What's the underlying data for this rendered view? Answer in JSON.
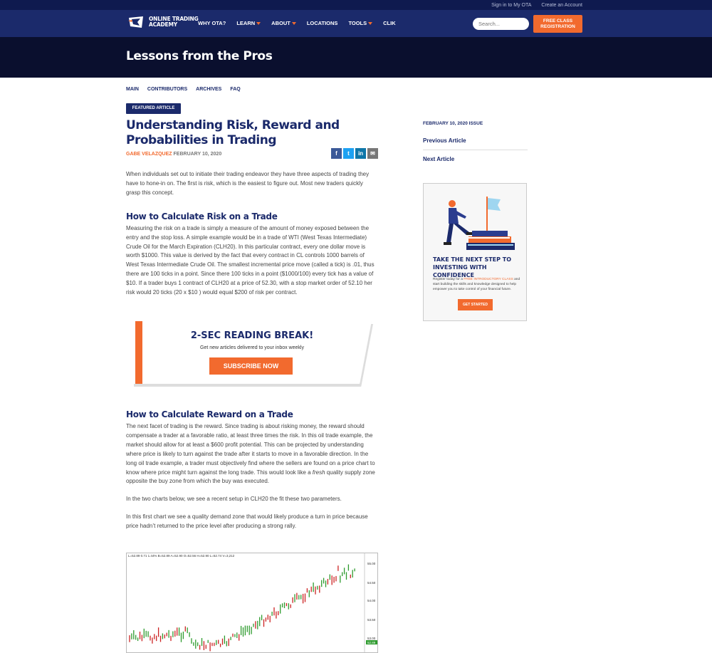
{
  "topbar": {
    "sign_in": "Sign in to My OTA",
    "create_account": "Create an Account"
  },
  "header": {
    "logo_line1": "ONLINE TRADING",
    "logo_line2": "ACADEMY",
    "nav": [
      {
        "label": "WHY OTA?",
        "has_caret": false
      },
      {
        "label": "LEARN",
        "has_caret": true
      },
      {
        "label": "ABOUT",
        "has_caret": true
      },
      {
        "label": "LOCATIONS",
        "has_caret": false
      },
      {
        "label": "TOOLS",
        "has_caret": true
      },
      {
        "label": "CLIK",
        "has_caret": false
      }
    ],
    "search_placeholder": "Search...",
    "register_line1": "FREE CLASS",
    "register_line2": "REGISTRATION"
  },
  "hero": {
    "title": "Lessons from the Pros"
  },
  "subnav": [
    "MAIN",
    "CONTRIBUTORS",
    "ARCHIVES",
    "FAQ"
  ],
  "article": {
    "badge": "FEATURED ARTICLE",
    "title": "Understanding Risk, Reward and Probabilities in Trading",
    "author": "GABE VELAZQUEZ",
    "date": "FEBRUARY 10, 2020",
    "intro": "When individuals set out to initiate their trading endeavor they have three aspects of trading they have to hone-in on. The first is risk, which is the easiest to figure out. Most new traders quickly grasp this concept.",
    "h_risk": "How to Calculate Risk on a Trade",
    "p_risk": "Measuring the risk on a trade is simply a measure of the amount of money exposed between the entry and the stop loss. A simple example would be in a trade of WTI (West Texas Intermediate) Crude Oil for the March Expiration (CLH20).  In this particular contract, every one dollar move is worth $1000. This value is derived by the fact that every contract in CL controls 1000 barrels of West Texas Intermediate Crude Oil. The smallest incremental price move (called a tick) is .01, thus there are 100 ticks in a point. Since there 100 ticks in a point ($1000/100) every tick has a value of $10.  If a trader buys 1 contract of CLH20 at a price of 52.30, with a stop market order of 52.10 her risk would 20 ticks (20 x $10 ) would equal $200 of risk per contract.",
    "h_reward": "How to Calculate Reward on a Trade",
    "p_reward_a": "The next facet of trading is the reward. Since trading is about risking money, the reward should compensate a trader at a favorable ratio, at least three times the risk. In this oil trade example, the market should allow for at least a $600 profit potential.  This can be projected by understanding where price is likely to turn against the trade after it starts to move in a favorable direction.  In the long oil trade example, a trader must objectively find where the sellers are found on a price chart to know where price might turn against the long trade. This would look like a ",
    "p_reward_em": "fresh",
    "p_reward_b": " quality supply zone opposite the buy zone from which the buy was executed.",
    "p_two_charts": "In the two charts below, we see a recent setup in CLH20 the fit these two parameters.",
    "p_first_chart": "In this first chart we see a quality demand zone that would likely produce a turn in price because price hadn’t returned to the price level after producing a strong rally."
  },
  "share": {
    "facebook": "f",
    "twitter": "t",
    "linkedin": "in",
    "email": "✉"
  },
  "reading_break": {
    "title": "2-SEC READING BREAK!",
    "subtitle": "Get new articles delivered to your inbox weekly",
    "button": "SUBSCRIBE NOW"
  },
  "sidebar": {
    "issue": "FEBRUARY 10, 2020 ISSUE",
    "previous": "Previous Article",
    "next": "Next Article"
  },
  "ad": {
    "title": "TAKE THE NEXT STEP TO INVESTING WITH CONFIDENCE",
    "text_a": "Register today for a ",
    "text_hl": "FREE INTRODUCTORY CLASS",
    "text_b": " and start building the skills and knowledge designed to help empower you to take control of your financial future.",
    "button": "GET STARTED"
  },
  "chart_data": {
    "type": "candlestick",
    "header": "L=52.89  0.71  1.44%  B=52.89  A=52.90  O=52.56  H=52.90  L=52.74  V=3,212",
    "y_ticks": [
      "55.00",
      "54.50",
      "54.00",
      "53.50",
      "53.00"
    ],
    "last_price": "52.89",
    "colors": {
      "up": "#2e9b2e",
      "down": "#cc2222"
    }
  }
}
